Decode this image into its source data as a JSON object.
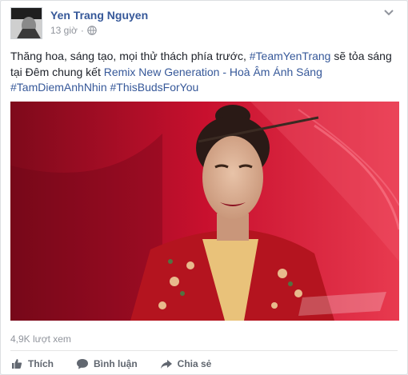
{
  "post": {
    "author": "Yen Trang Nguyen",
    "time": "13 giờ",
    "separator": "·",
    "text_plain_1": "Thăng hoa, sáng tạo, mọi thử thách phía trước, ",
    "hashtag_team": "#TeamYenTrang",
    "text_plain_2": " sẽ tỏa sáng tại Đêm chung kết ",
    "remix_title": "Remix New Generation - Hoà Âm Ánh Sáng",
    "hashtag_1": "#TamDiemAnhNhin",
    "hashtag_2": "#ThisBudsForYou",
    "views": "4,9K lượt xem"
  },
  "actions": {
    "like": "Thích",
    "comment": "Bình luận",
    "share": "Chia sẻ"
  },
  "colors": {
    "link": "#365899",
    "action": "#616770",
    "meta": "#90949c"
  },
  "icons": [
    "globe-icon",
    "chevron-down-icon",
    "like-icon",
    "comment-icon",
    "share-icon"
  ]
}
